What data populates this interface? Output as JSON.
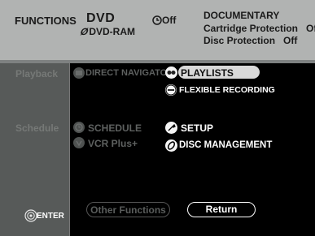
{
  "header": {
    "functions": "FUNCTIONS",
    "disc_type": "DVD",
    "disc_sub": "DVD-RAM",
    "timer": "Off",
    "title": "DOCUMENTARY",
    "cartridge_label": "Cartridge Protection",
    "cartridge_value": "Off",
    "disc_protection_label": "Disc Protection",
    "disc_protection_value": "Off"
  },
  "left": {
    "playback": "Playback",
    "schedule": "Schedule"
  },
  "center": {
    "direct_navigator": "DIRECT NAVIGATOR",
    "schedule": "SCHEDULE",
    "vcr_plus": "VCR Plus+"
  },
  "right": {
    "playlists": "PLAYLISTS",
    "flexible_recording": "FLEXIBLE RECORDING",
    "setup": "SETUP",
    "disc_management": "DISC MANAGEMENT"
  },
  "footer": {
    "enter": "ENTER",
    "other_functions": "Other Functions",
    "return": "Return"
  },
  "colors": {
    "header_bg": "#b1b3b2",
    "left_bg": "#575a59",
    "panel_bg": "#000000",
    "highlight": "#d9d9d9"
  }
}
